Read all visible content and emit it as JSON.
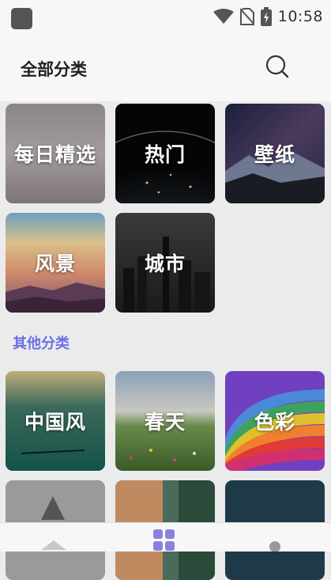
{
  "status_bar": {
    "time": "10:58",
    "icons": [
      "app-icon",
      "wifi-icon",
      "no-sim-icon",
      "battery-icon"
    ]
  },
  "header": {
    "title": "全部分类",
    "search_icon": "search-icon"
  },
  "categories": [
    {
      "label": "每日精选"
    },
    {
      "label": "热门"
    },
    {
      "label": "壁纸"
    },
    {
      "label": "风景"
    },
    {
      "label": "城市"
    }
  ],
  "other_section": {
    "title": "其他分类",
    "items": [
      {
        "label": "中国风"
      },
      {
        "label": "春天"
      },
      {
        "label": "色彩"
      }
    ]
  },
  "bottom_nav": {
    "icons": [
      "home-icon",
      "category-grid-icon",
      "profile-icon"
    ]
  },
  "colors": {
    "accent": "#6b6fe6",
    "background": "#ebebeb"
  }
}
